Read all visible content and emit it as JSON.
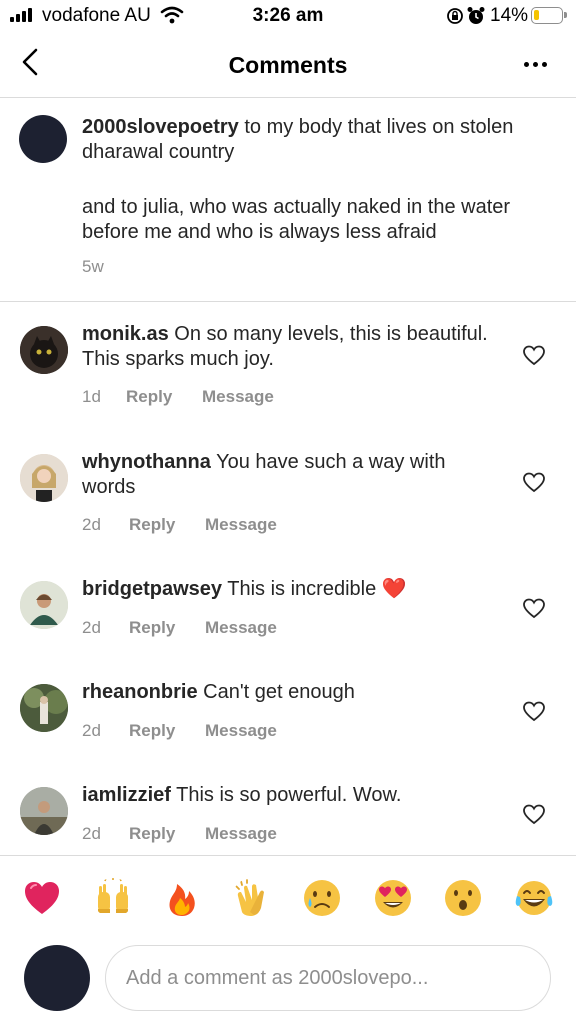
{
  "status_bar": {
    "carrier": "vodafone AU",
    "time": "3:26 am",
    "battery": "14%",
    "battery_level": 0.14
  },
  "header": {
    "title": "Comments"
  },
  "caption": {
    "username": "2000slovepoetry",
    "line1": "to my body that lives on stolen dharawal country",
    "line2": "and to julia, who was actually naked in the water before me and who is always less afraid",
    "time": "5w"
  },
  "comments": [
    {
      "username": "monik.as",
      "text": "On so many levels, this is beautiful. This sparks much joy.",
      "time": "1d",
      "reply": "Reply",
      "message": "Message"
    },
    {
      "username": "whynothanna",
      "text": "You have such a way with words",
      "time": "2d",
      "reply": "Reply",
      "message": "Message"
    },
    {
      "username": "bridgetpawsey",
      "text": "This is incredible ❤️",
      "time": "2d",
      "reply": "Reply",
      "message": "Message"
    },
    {
      "username": "rheanonbrie",
      "text": "Can't get enough",
      "time": "2d",
      "reply": "Reply",
      "message": "Message"
    },
    {
      "username": "iamlizzief",
      "text": "This is so powerful. Wow.",
      "time": "2d",
      "reply": "Reply",
      "message": "Message"
    }
  ],
  "emoji_bar": [
    "red-heart",
    "raising-hands",
    "fire",
    "clapping-hands",
    "crying-face",
    "heart-eyes",
    "astonished-face",
    "tears-of-joy"
  ],
  "composer": {
    "placeholder": "Add a comment as 2000slovepo..."
  },
  "colors": {
    "text": "#262626",
    "secondary": "#8e8e8e",
    "divider": "#dbdbdb",
    "battery_low": "#f5c400",
    "heart_red": "#e0245e"
  }
}
